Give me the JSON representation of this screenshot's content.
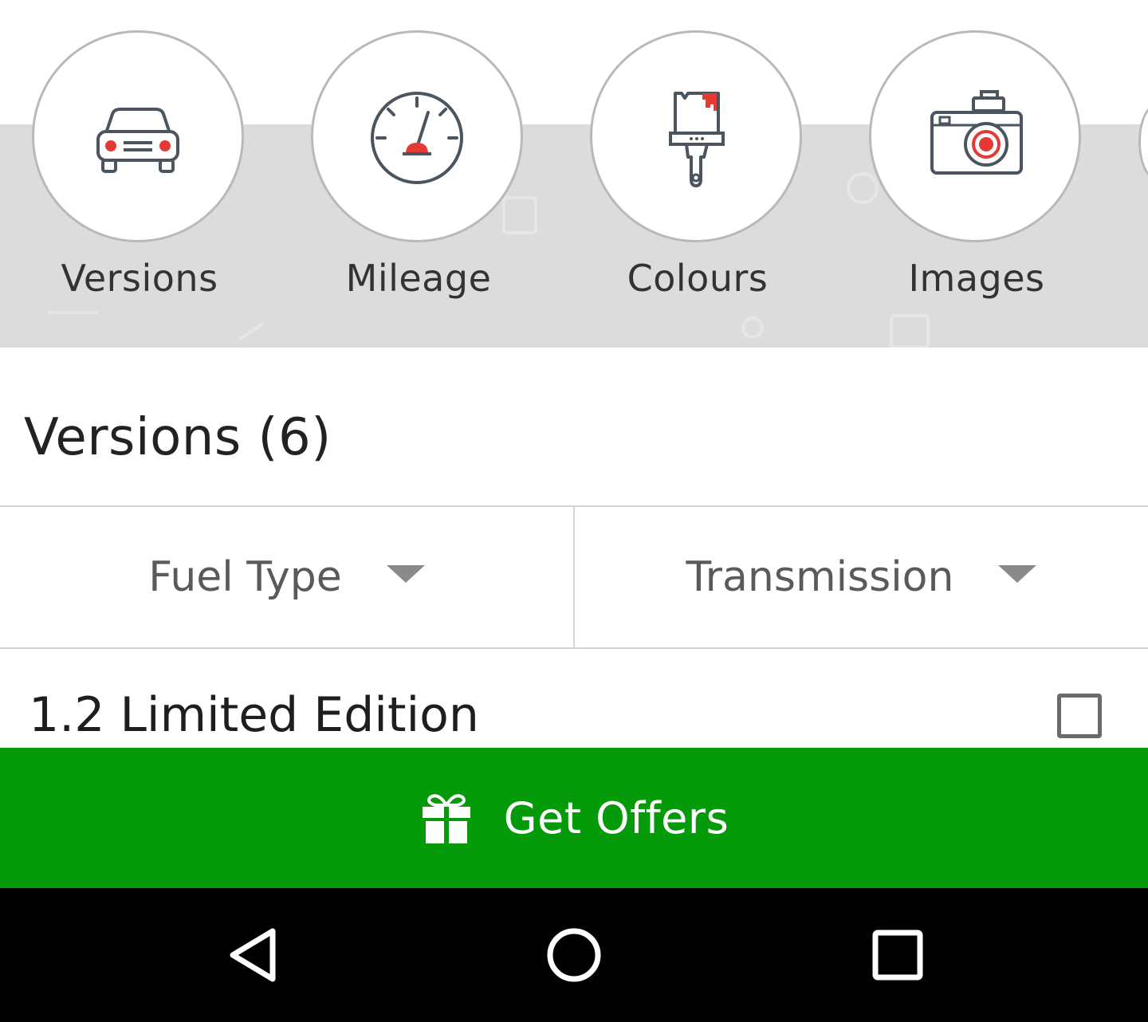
{
  "categories": [
    {
      "label": "Versions",
      "icon": "car-icon"
    },
    {
      "label": "Mileage",
      "icon": "speedometer-icon"
    },
    {
      "label": "Colours",
      "icon": "paintbrush-icon"
    },
    {
      "label": "Images",
      "icon": "camera-icon"
    }
  ],
  "versions": {
    "title": "Versions (6)",
    "filters": [
      {
        "label": "Fuel Type"
      },
      {
        "label": "Transmission"
      }
    ],
    "items": [
      {
        "name": "1.2 Limited Edition",
        "checked": false
      }
    ]
  },
  "cta": {
    "label": "Get Offers",
    "icon": "gift-icon",
    "color": "#059a0a"
  },
  "system_nav": {
    "back_icon": "back-triangle-icon",
    "home_icon": "home-circle-icon",
    "recents_icon": "recents-square-icon"
  },
  "colors": {
    "accent_red": "#e53935",
    "band_gray": "#dcdcdc",
    "cta_green": "#059a0a"
  }
}
